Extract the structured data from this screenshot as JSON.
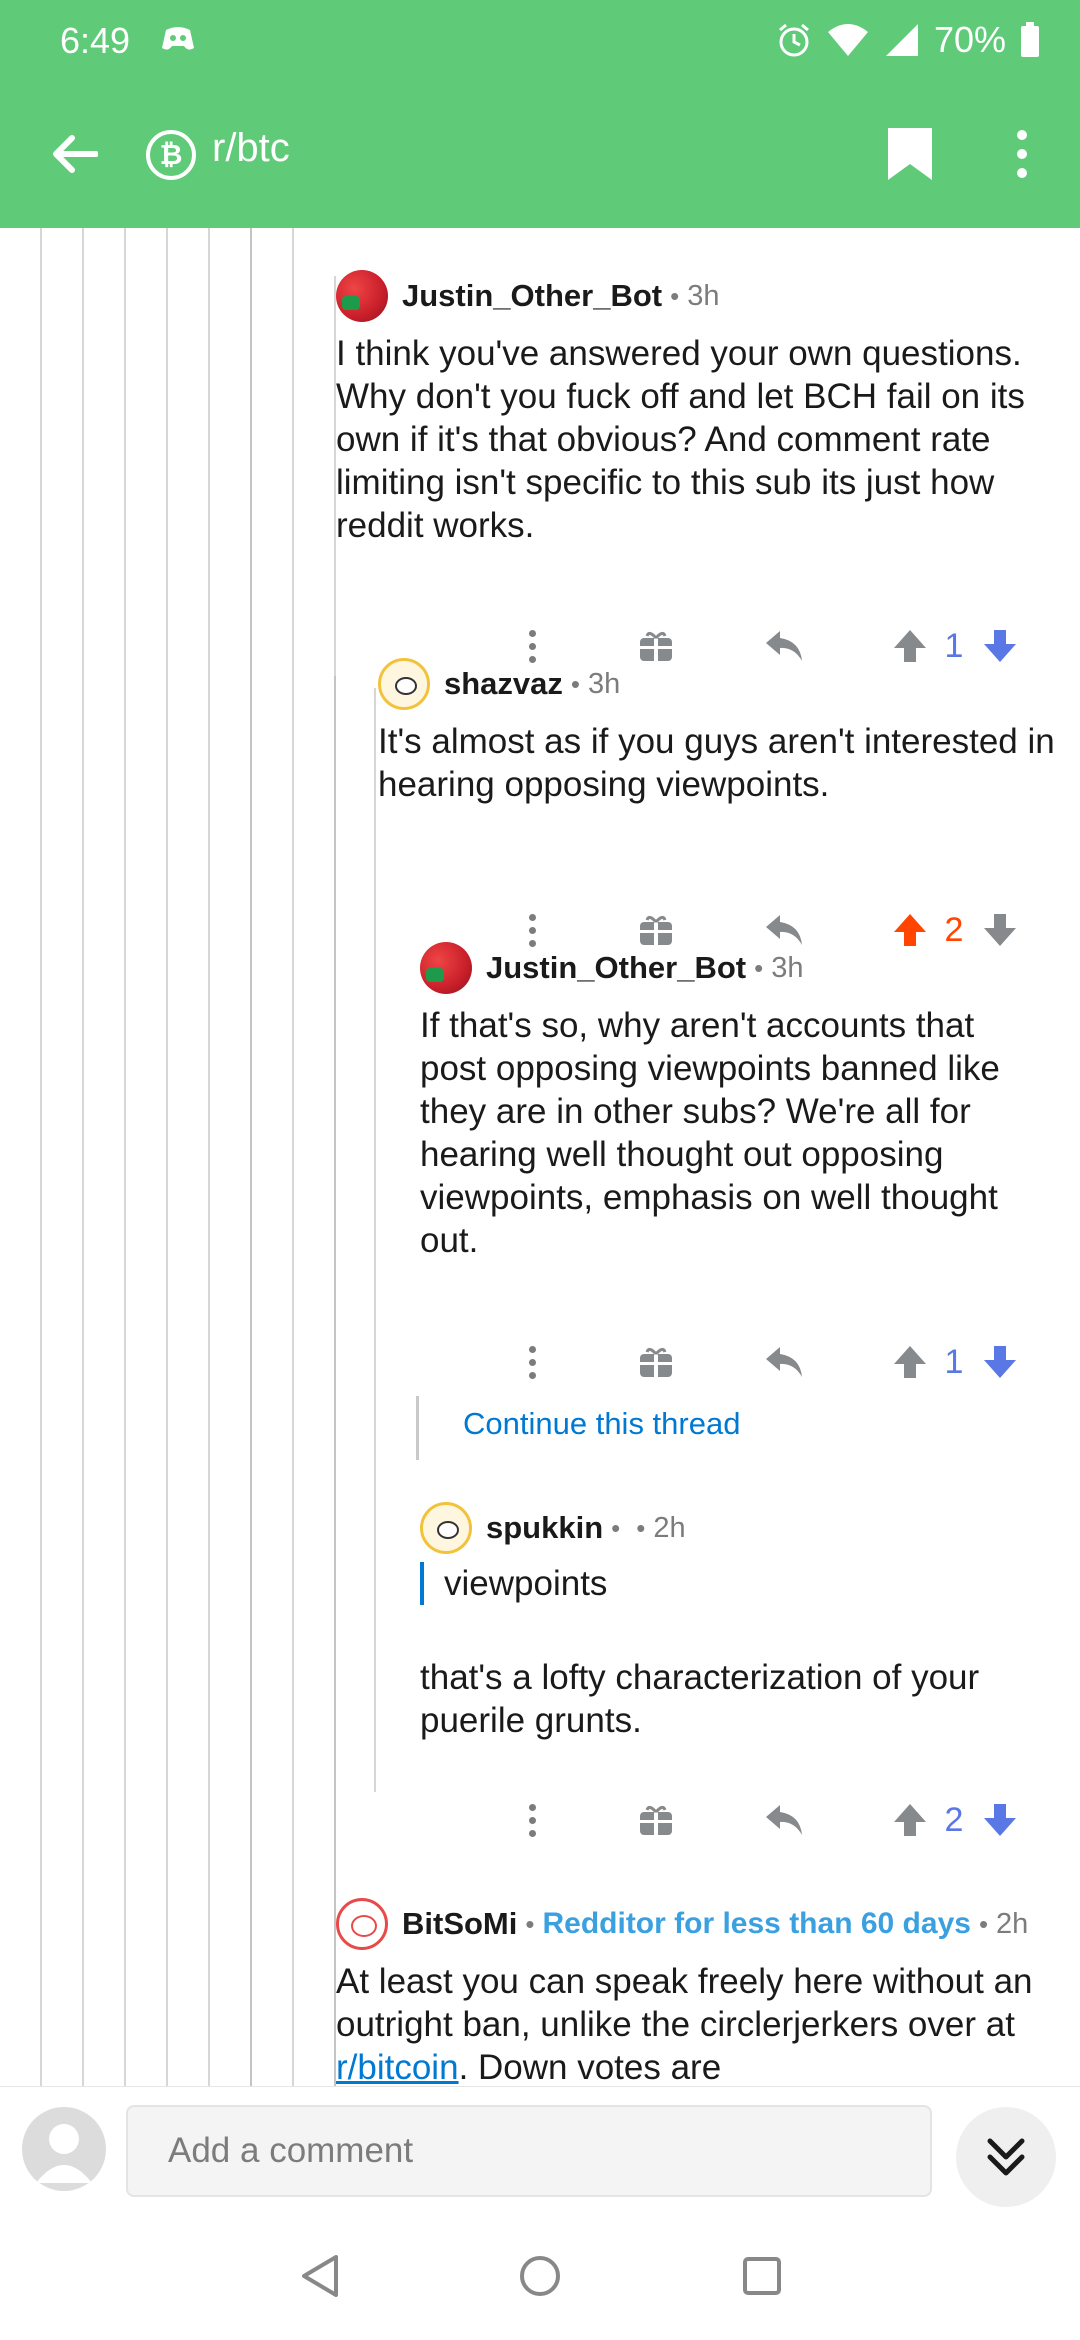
{
  "status_bar": {
    "time": "6:49",
    "battery": "70%"
  },
  "app_bar": {
    "subreddit": "r/btc",
    "badge": "₿"
  },
  "comments": [
    {
      "author": "Justin_Other_Bot",
      "age": "3h",
      "body": "I think you've answered your own questions. Why don't you fuck off and let BCH fail on its own if it's that obvious? And comment rate limiting isn't specific to this sub its just how reddit works.",
      "score": "1",
      "vote": "down"
    },
    {
      "author": "shazvaz",
      "age": "3h",
      "body": "It's almost as if you guys aren't interested in hearing opposing viewpoints.",
      "score": "2",
      "vote": "up"
    },
    {
      "author": "Justin_Other_Bot",
      "age": "3h",
      "body": "If that's so, why aren't accounts that post opposing viewpoints banned like they are in other subs? We're all for hearing well thought out opposing viewpoints, emphasis on well thought out.",
      "score": "1",
      "vote": "down"
    },
    {
      "author": "spukkin",
      "age": "2h",
      "quote": "viewpoints",
      "body": "that's a lofty characterization of your puerile grunts.",
      "score": "2",
      "vote": "down"
    },
    {
      "author": "BitSoMi",
      "flair": "Redditor for less than 60 days",
      "age": "2h",
      "body_before": "At least you can speak freely here without an outright ban, unlike the circlerjerkers over at ",
      "link": "r/bitcoin",
      "body_after": ". Down votes are"
    }
  ],
  "continue_thread": "Continue this thread",
  "comment_bar": {
    "placeholder": "Add a comment"
  },
  "colors": {
    "header": "#5fcb78",
    "link": "#0079d3",
    "upvote": "#ff4500",
    "downvote": "#5a77e6",
    "flair": "#3ba0e0"
  }
}
